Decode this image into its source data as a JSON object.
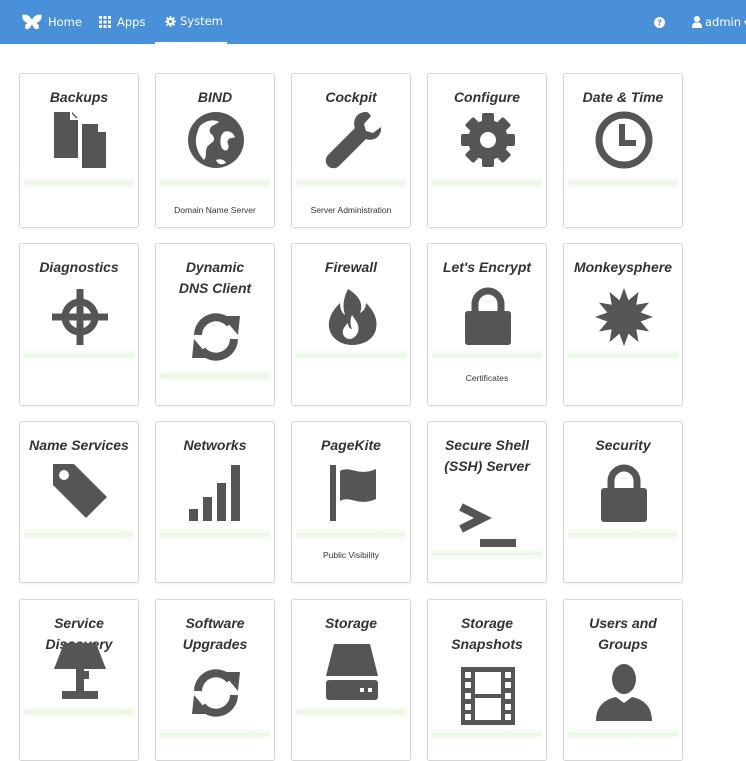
{
  "navbar": {
    "home_label": "Home",
    "apps_label": "Apps",
    "system_label": "System",
    "user_label": "admin",
    "active_tab": "System",
    "background_color": "#4a90d9"
  },
  "cards": [
    {
      "title": "Backups",
      "description": "",
      "icon": "documents-icon"
    },
    {
      "title": "BIND",
      "description": "Domain Name Server",
      "icon": "globe-icon"
    },
    {
      "title": "Cockpit",
      "description": "Server Administration",
      "icon": "wrench-icon"
    },
    {
      "title": "Configure",
      "description": "",
      "icon": "gear-icon"
    },
    {
      "title": "Date & Time",
      "description": "",
      "icon": "clock-icon"
    },
    {
      "title": "Diagnostics",
      "description": "",
      "icon": "crosshair-icon"
    },
    {
      "title": "Dynamic DNS Client",
      "description": "",
      "icon": "refresh-icon"
    },
    {
      "title": "Firewall",
      "description": "",
      "icon": "fire-icon"
    },
    {
      "title": "Let's Encrypt",
      "description": "Certificates",
      "icon": "lock-icon"
    },
    {
      "title": "Monkeysphere",
      "description": "",
      "icon": "certificate-icon"
    },
    {
      "title": "Name Services",
      "description": "",
      "icon": "tag-icon"
    },
    {
      "title": "Networks",
      "description": "",
      "icon": "signal-icon"
    },
    {
      "title": "PageKite",
      "description": "Public Visibility",
      "icon": "flag-icon"
    },
    {
      "title": "Secure Shell (SSH) Server",
      "description": "",
      "icon": "terminal-icon"
    },
    {
      "title": "Security",
      "description": "",
      "icon": "lock-icon"
    },
    {
      "title": "Service Discovery",
      "description": "",
      "icon": "lamp-icon"
    },
    {
      "title": "Software Upgrades",
      "description": "",
      "icon": "refresh-icon"
    },
    {
      "title": "Storage",
      "description": "",
      "icon": "hdd-icon"
    },
    {
      "title": "Storage Snapshots",
      "description": "",
      "icon": "film-icon"
    },
    {
      "title": "Users and Groups",
      "description": "",
      "icon": "user-icon"
    }
  ]
}
